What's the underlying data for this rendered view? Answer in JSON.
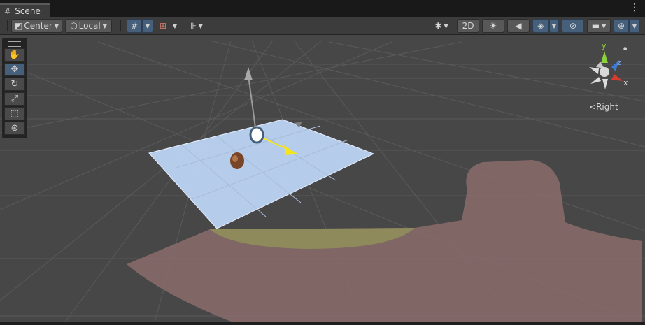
{
  "tab": {
    "title": "Scene",
    "icon": "grid-icon"
  },
  "toolbar": {
    "pivot_mode": "Center",
    "pivot_rotation": "Local",
    "two_d": "2D"
  },
  "tools": [
    {
      "name": "hand-tool",
      "icon": "hand-icon",
      "active": false
    },
    {
      "name": "move-tool",
      "icon": "move-icon",
      "active": true
    },
    {
      "name": "rotate-tool",
      "icon": "rotate-icon",
      "active": false
    },
    {
      "name": "scale-tool",
      "icon": "scale-icon",
      "active": false
    },
    {
      "name": "rect-tool",
      "icon": "rect-icon",
      "active": false
    },
    {
      "name": "transform-tool",
      "icon": "transform-icon",
      "active": false
    }
  ],
  "orientation_gizmo": {
    "axes": {
      "y": "y",
      "z": "z",
      "x": "x"
    },
    "view_label": "Right",
    "colors": {
      "x": "#db3b2e",
      "y": "#8cd13b",
      "z": "#3d7bd8"
    }
  },
  "colors": {
    "viewport_bg": "#474747",
    "plane": "#bcd4f3",
    "character": "#8a6b6b",
    "accent_blue": "#46607c",
    "move_arrow": "#f5e51a"
  }
}
